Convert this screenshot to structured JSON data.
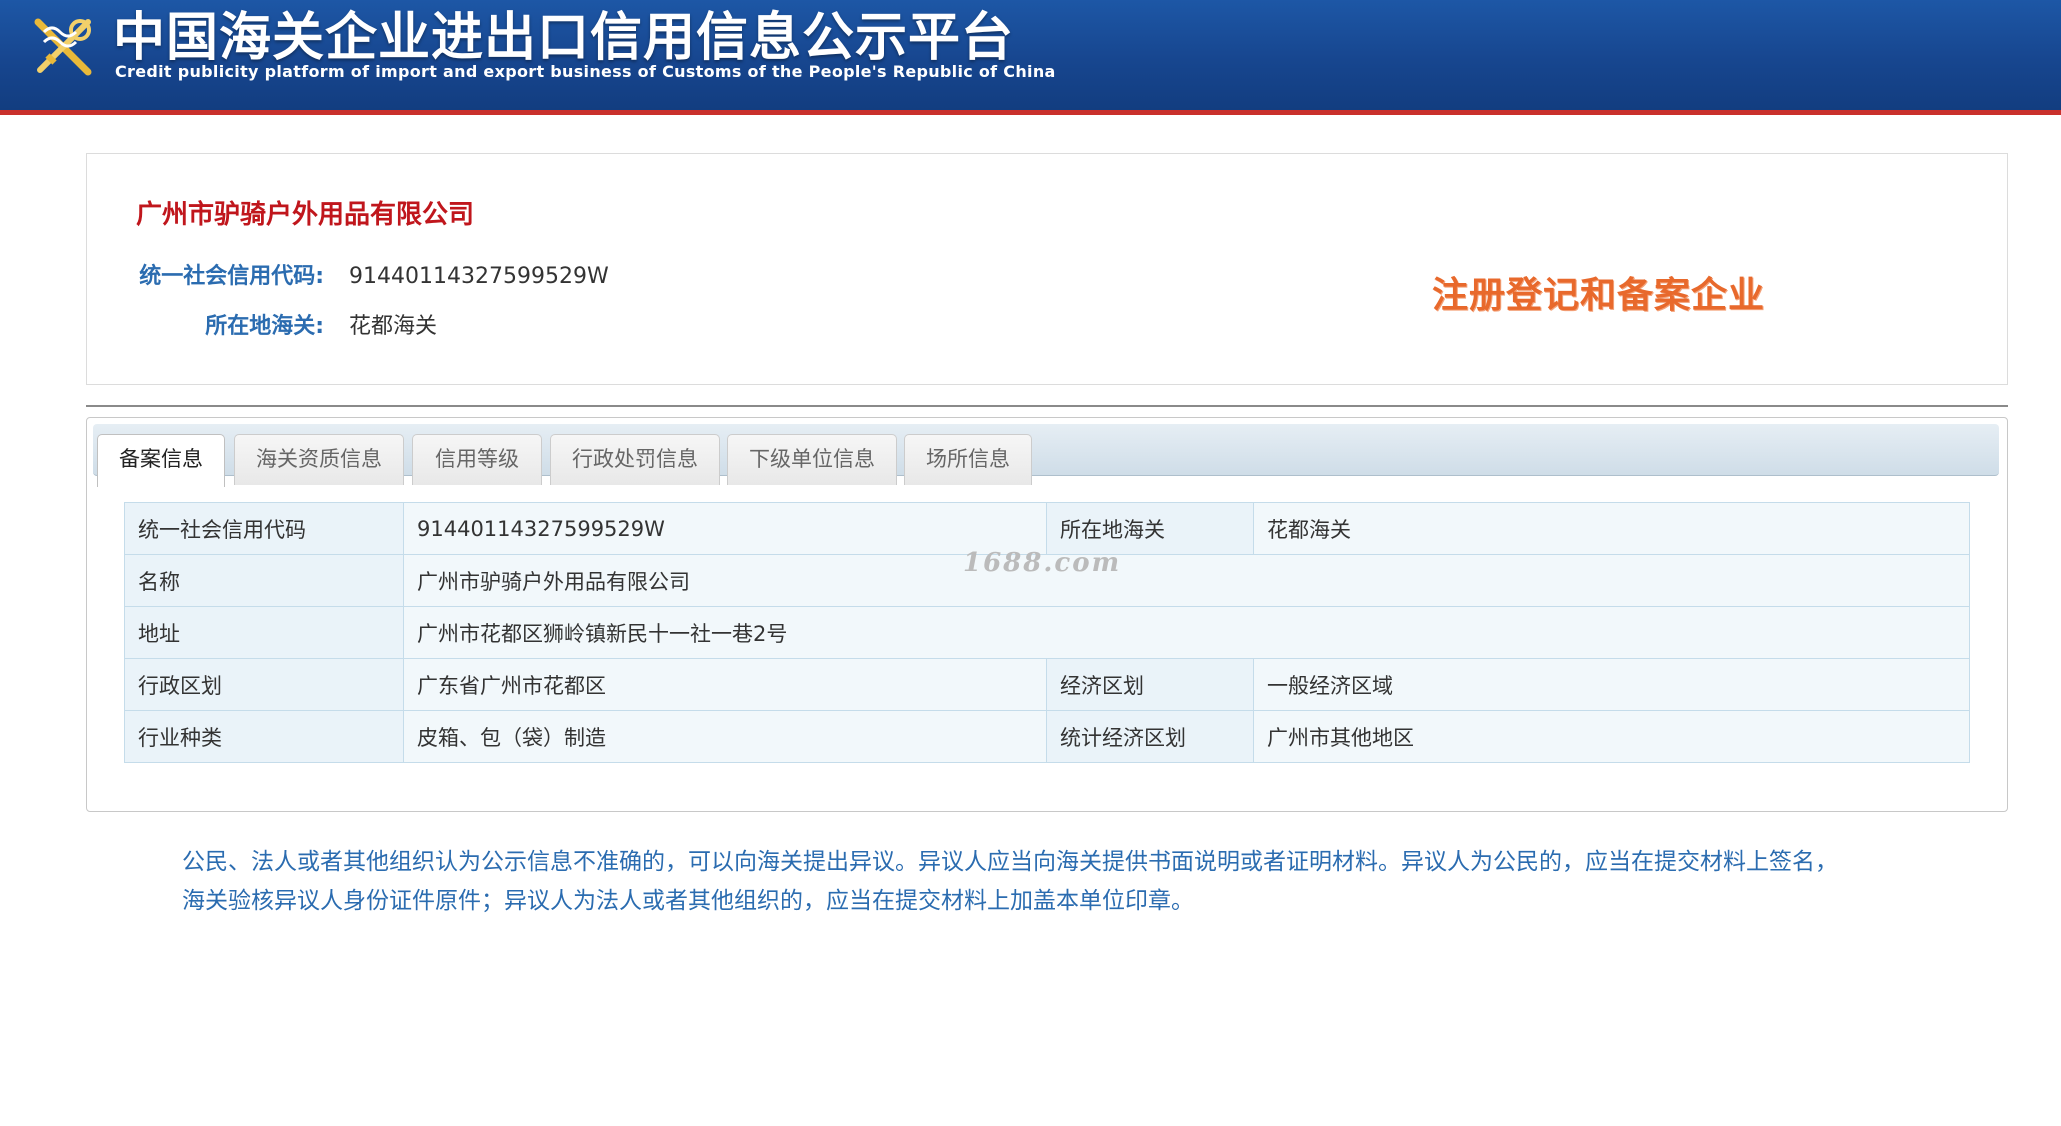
{
  "header": {
    "title": "中国海关企业进出口信用信息公示平台",
    "subtitle": "Credit publicity platform of import and export business of Customs of the People's Republic of China",
    "logo_icon": "customs-emblem-icon",
    "background_color": "#17468f",
    "accent_line_color": "#c9302c"
  },
  "company": {
    "name": "广州市驴骑户外用品有限公司",
    "credit_code_label": "统一社会信用代码:",
    "credit_code_value": "91440114327599529W",
    "customs_label": "所在地海关:",
    "customs_value": "花都海关",
    "status_stamp": "注册登记和备案企业",
    "name_color": "#c0161c",
    "stamp_color": "#e8692c"
  },
  "tabs": [
    {
      "label": "备案信息",
      "active": true
    },
    {
      "label": "海关资质信息",
      "active": false
    },
    {
      "label": "信用等级",
      "active": false
    },
    {
      "label": "行政处罚信息",
      "active": false
    },
    {
      "label": "下级单位信息",
      "active": false
    },
    {
      "label": "场所信息",
      "active": false
    }
  ],
  "table": {
    "rows": [
      {
        "label1": "统一社会信用代码",
        "value1": "91440114327599529W",
        "label2": "所在地海关",
        "value2": "花都海关"
      },
      {
        "label1": "名称",
        "value1": "广州市驴骑户外用品有限公司"
      },
      {
        "label1": "地址",
        "value1": "广州市花都区狮岭镇新民十一社一巷2号"
      },
      {
        "label1": "行政区划",
        "value1": "广东省广州市花都区",
        "label2": "经济区划",
        "value2": "一般经济区域"
      },
      {
        "label1": "行业种类",
        "value1": "皮箱、包（袋）制造",
        "label2": "统计经济区划",
        "value2": "广州市其他地区"
      }
    ]
  },
  "watermark": "1688.com",
  "notice": {
    "line1": "公民、法人或者其他组织认为公示信息不准确的，可以向海关提出异议。异议人应当向海关提供书面说明或者证明材料。异议人为公民的，应当在提交材料上签名，",
    "line2": "海关验核异议人身份证件原件；异议人为法人或者其他组织的，应当在提交材料上加盖本单位印章。",
    "color": "#2b6cb0"
  }
}
